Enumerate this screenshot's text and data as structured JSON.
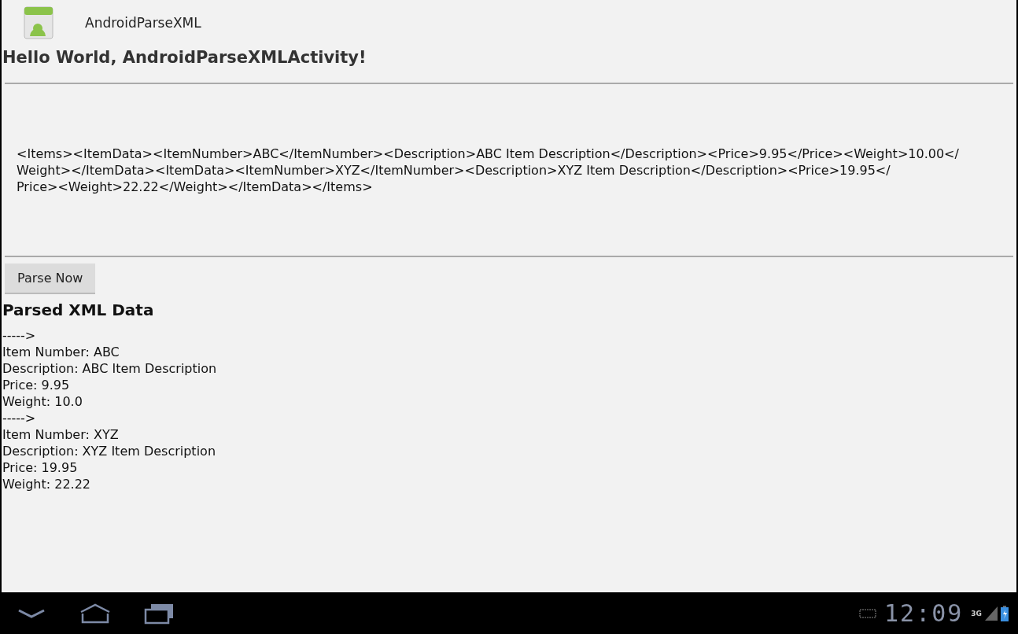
{
  "app_bar": {
    "title": "AndroidParseXML"
  },
  "greeting": "Hello World, AndroidParseXMLActivity!",
  "xml_field": {
    "lines": [
      "<Items><ItemData><ItemNumber>ABC</ItemNumber><Description>ABC Item Description</Description><Price>9.95</Price><Weight>10.00</",
      "Weight></ItemData><ItemData><ItemNumber>XYZ</ItemNumber><Description>XYZ Item Description</Description><Price>19.95</",
      "Price><Weight>22.22</Weight></ItemData></Items>"
    ]
  },
  "parse_button": "Parse Now",
  "result_heading": "Parsed XML Data",
  "result_lines": [
    "----->",
    "Item Number: ABC",
    "Description: ABC Item Description",
    "Price: 9.95",
    "Weight: 10.0",
    "----->",
    "Item Number: XYZ",
    "Description: XYZ Item Description",
    "Price: 19.95",
    "Weight: 22.22"
  ],
  "system_bar": {
    "clock": "12:09",
    "network": "3G"
  }
}
